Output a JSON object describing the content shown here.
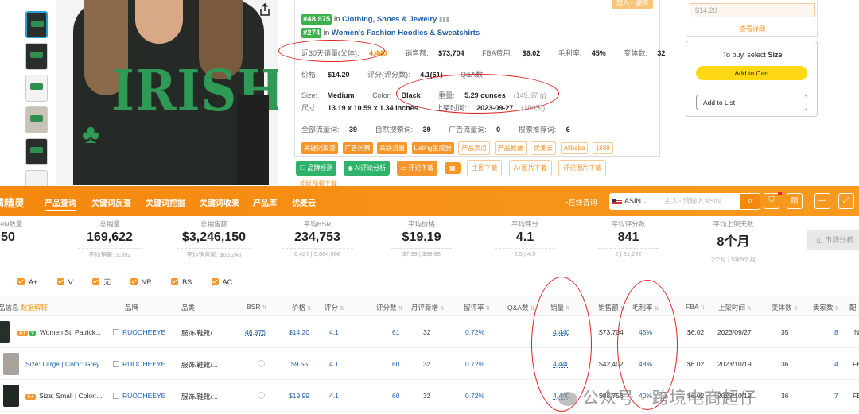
{
  "amazon": {
    "top_button": "加入一键购",
    "ranks": [
      {
        "rank": "#48,975",
        "prefix": "in",
        "category": "Clothing, Shoes & Jewelry"
      },
      {
        "rank": "#274",
        "prefix": "in",
        "category": "Women's Fashion Hoodies & Sweatshirts"
      }
    ],
    "row1": {
      "sales30_label": "近30天销量(父体):",
      "sales30_value": "4,440",
      "revenue_label": "销售额:",
      "revenue_value": "$73,704",
      "fba_label": "FBA费用:",
      "fba_value": "$6.02",
      "margin_label": "毛利率:",
      "margin_value": "45%",
      "variants_label": "变体数:",
      "variants_value": "32"
    },
    "row2": {
      "price_label": "价格:",
      "price_value": "$14.20",
      "rating_label": "评分(评分数):",
      "rating_value": "4.1(61)",
      "qa_label": "Q&A数:",
      "qa_value": "--"
    },
    "row3": {
      "size_label": "Size:",
      "size_value": "Medium",
      "color_label": "Color:",
      "color_value": "Black",
      "weight_label": "重量:",
      "weight_value": "5.29 ounces",
      "weight_extra": "(149.97 g)"
    },
    "row4": {
      "dim_label": "尺寸:",
      "dim_value": "13.19 x 10.59 x 1.34 inches",
      "launch_label": "上架时间:",
      "launch_value": "2023-09-27",
      "launch_extra": "(180天)"
    },
    "row5": {
      "all_label": "全部流量词:",
      "all_value": "39",
      "organic_label": "自然搜索词:",
      "organic_value": "39",
      "ad_label": "广告流量词:",
      "ad_value": "0",
      "rec_label": "搜索推荐词:",
      "rec_value": "6"
    },
    "tags": [
      {
        "label": "关键词反查",
        "style": "o"
      },
      {
        "label": "广告洞察",
        "style": "o"
      },
      {
        "label": "关联流量",
        "style": "o"
      },
      {
        "label": "Listing生成器",
        "style": "o"
      },
      {
        "label": "产品卖点",
        "style": "l"
      },
      {
        "label": "产品概要",
        "style": "l"
      },
      {
        "label": "优麦云",
        "style": "l"
      },
      {
        "label": "Alibaba",
        "style": "l"
      },
      {
        "label": "1688",
        "style": "l"
      }
    ],
    "buttons": {
      "brand_check": "品牌检测",
      "ai_review": "AI评论分析",
      "review_download": "评论下载",
      "main_image_download": "主图下载",
      "aplus_download": "A+图片下载",
      "review_image_download": "评论图片下载",
      "video_download": "关联视频下载"
    },
    "buybox": {
      "price": "$14.20",
      "detail": "查看详细",
      "to_buy_prefix": "To buy, select",
      "to_buy_bold": "Size",
      "add_to_cart": "Add to Cart",
      "add_to_list": "Add to List"
    }
  },
  "plugin": {
    "brand": "霸精灵",
    "nav": [
      "产品查询",
      "关键词反查",
      "关键词挖掘",
      "关键词收录",
      "产品库",
      "优麦云"
    ],
    "online": "在线咨询",
    "asin_select": "ASIN",
    "asin_placeholder": "主人~请输入ASIN",
    "stats": [
      {
        "title": "ASIN数量",
        "value": "50",
        "sub": ""
      },
      {
        "title": "总销量",
        "value": "169,622",
        "sub": "平均销量: 3,392"
      },
      {
        "title": "总销售额",
        "value": "$3,246,150",
        "sub": "平均销售额: $66,248"
      },
      {
        "title": "平均BSR",
        "value": "234,753",
        "sub": "6,427 | 5,884,068"
      },
      {
        "title": "平均价格",
        "value": "$19.19",
        "sub": "$7.99 | $39.88"
      },
      {
        "title": "平均评分",
        "value": "4.1",
        "sub": "2.5 | 4.5"
      },
      {
        "title": "平均评分数",
        "value": "841",
        "sub": "2 | 31,292"
      },
      {
        "title": "平均上架天数",
        "value": "8个月",
        "sub": "2个月 | 5年9个月"
      }
    ],
    "market_button": "市场分析",
    "filters": [
      "A+",
      "V",
      "无",
      "NR",
      "BS",
      "AC"
    ],
    "columns": [
      "品信息",
      "数据解释",
      "品牌",
      "品类",
      "BSR",
      "价格",
      "评分",
      "评分数",
      "月评新增",
      "留评率",
      "Q&A数",
      "销量",
      "销售额",
      "毛利率",
      "FBA",
      "上架时间",
      "变体数",
      "卖家数",
      "配"
    ],
    "rows": [
      {
        "badges": [
          "A+",
          "V"
        ],
        "title": "Women St. Patrick...",
        "brand": "RUOOHEEYE",
        "category": "服饰/鞋靴/...",
        "bsr": "48,975",
        "price": "$14.20",
        "rating": "4.1",
        "ratings": "61",
        "monthly": "32",
        "review_rate": "0.72%",
        "sales": "4,440",
        "revenue": "$73,704",
        "margin": "45%",
        "fba": "$6.02",
        "launch": "2023/09/27",
        "variants": "35",
        "sellers": "8",
        "extra": "N"
      },
      {
        "badges": [],
        "title": "Size: Large | Color: Grey",
        "brand": "RUOOHEEYE",
        "category": "服饰/鞋靴/...",
        "bsr": "",
        "price": "$9.55",
        "rating": "4.1",
        "ratings": "60",
        "monthly": "32",
        "review_rate": "0.72%",
        "sales": "4,440",
        "revenue": "$42,402",
        "margin": "48%",
        "fba": "$6.02",
        "launch": "2023/10/19",
        "variants": "36",
        "sellers": "4",
        "extra": "FE"
      },
      {
        "badges": [
          "A+"
        ],
        "title": "Size: Small | Color:...",
        "brand": "RUOOHEEYE",
        "category": "服饰/鞋靴/...",
        "bsr": "",
        "price": "$19.99",
        "rating": "4.1",
        "ratings": "60",
        "monthly": "32",
        "review_rate": "0.72%",
        "sales": "4,440",
        "revenue": "$88,756",
        "margin": "40%",
        "fba": "$6.02",
        "launch": "2023/10/19",
        "variants": "36",
        "sellers": "7",
        "extra": "FE"
      }
    ]
  },
  "watermark": "公众号 · 跨境电商超仔",
  "colors": {
    "accent": "#f5880f",
    "link": "#1f5fa8",
    "green": "#3bb14a",
    "annotation_red": "#e0201f"
  }
}
